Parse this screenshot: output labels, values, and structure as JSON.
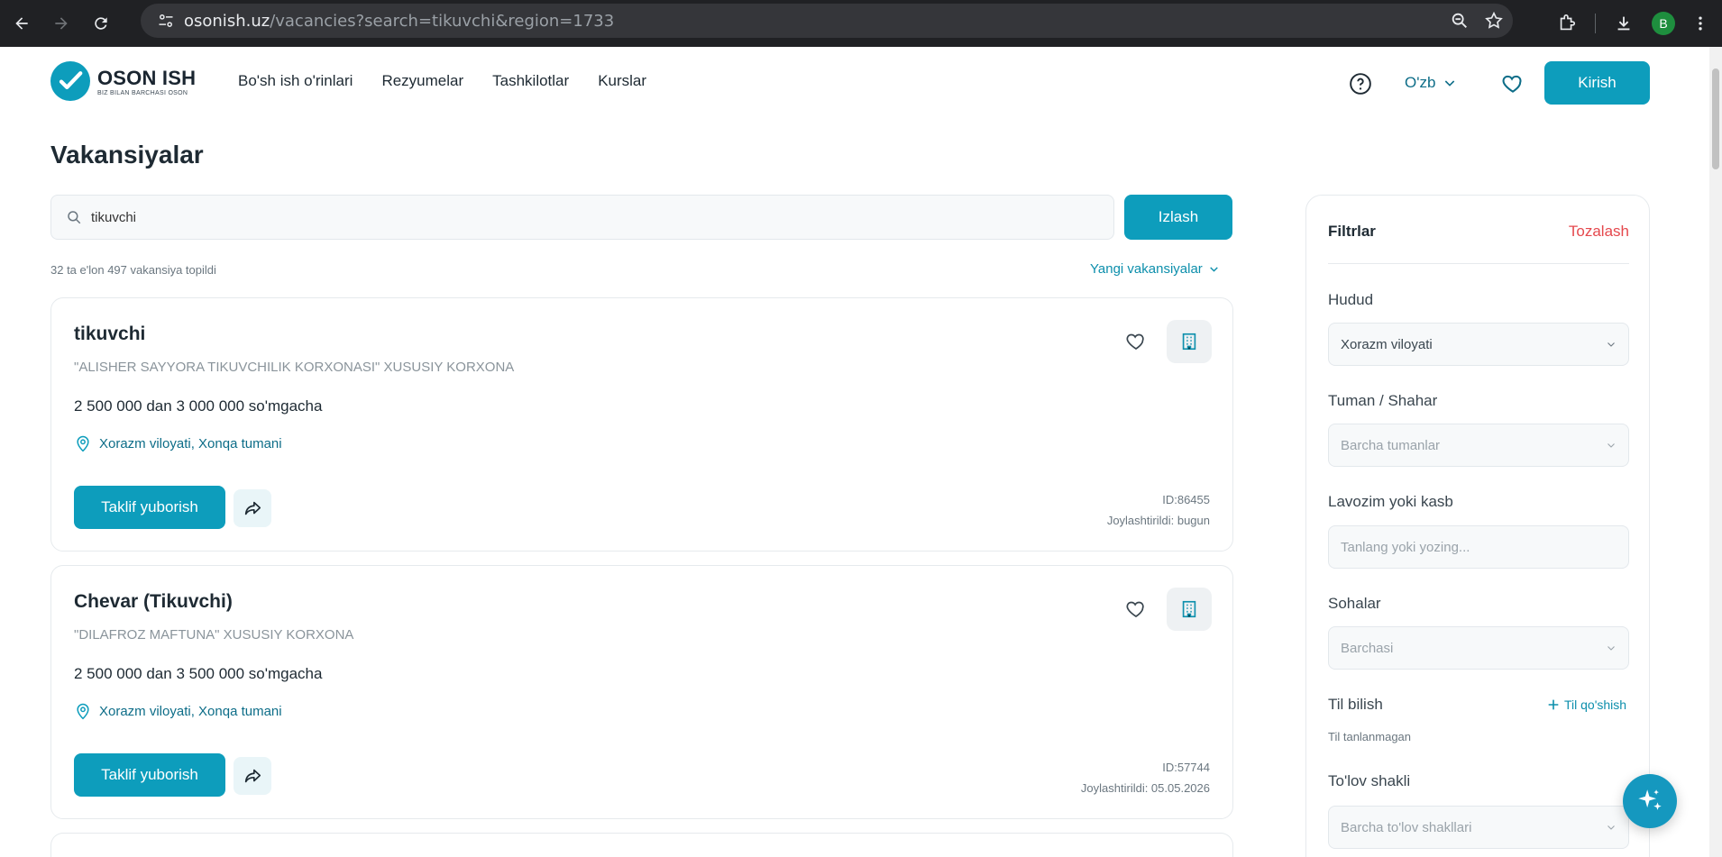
{
  "browser": {
    "url_host": "osonish.uz",
    "url_path": "/vacancies?search=tikuvchi&region=1733",
    "profile_initial": "B"
  },
  "header": {
    "logo_title": "OSON ISH",
    "logo_subtitle": "BIZ BILAN BARCHASI OSON",
    "nav": [
      "Bo'sh ish o'rinlari",
      "Rezyumelar",
      "Tashkilotlar",
      "Kurslar"
    ],
    "language": "O'zb",
    "login_label": "Kirish"
  },
  "page": {
    "title": "Vakansiyalar",
    "search_value": "tikuvchi",
    "search_button": "Izlash",
    "result_count": "32 ta e'lon 497 vakansiya topildi",
    "sort_label": "Yangi vakansiyalar"
  },
  "vacancies": [
    {
      "title": "tikuvchi",
      "company": "\"ALISHER SAYYORA TIKUVCHILIK KORXONASI\" XUSUSIY KORXONA",
      "salary": "2 500 000 dan 3 000 000 so'mgacha",
      "location": "Xorazm viloyati, Xonqa tumani",
      "offer_button": "Taklif yuborish",
      "id": "ID:86455",
      "posted": "Joylashtirildi: bugun"
    },
    {
      "title": "Chevar (Tikuvchi)",
      "company": "\"DILAFROZ MAFTUNA\" XUSUSIY KORXONA",
      "salary": "2 500 000 dan 3 500 000 so'mgacha",
      "location": "Xorazm viloyati, Xonqa tumani",
      "offer_button": "Taklif yuborish",
      "id": "ID:57744",
      "posted": "Joylashtirildi: 05.05.2026"
    }
  ],
  "filters": {
    "title": "Filtrlar",
    "clear": "Tozalash",
    "region_label": "Hudud",
    "region_value": "Xorazm viloyati",
    "district_label": "Tuman / Shahar",
    "district_placeholder": "Barcha tumanlar",
    "position_label": "Lavozim yoki kasb",
    "position_placeholder": "Tanlang yoki yozing...",
    "sector_label": "Sohalar",
    "sector_value": "Barchasi",
    "language_label": "Til bilish",
    "add_language": "Til qo'shish",
    "language_note": "Til tanlanmagan",
    "payment_label": "To'lov shakli",
    "payment_value": "Barcha to'lov shakllari"
  },
  "colors": {
    "brand": "#0d9dbc",
    "danger": "#e5484d",
    "link": "#0d6d88"
  }
}
